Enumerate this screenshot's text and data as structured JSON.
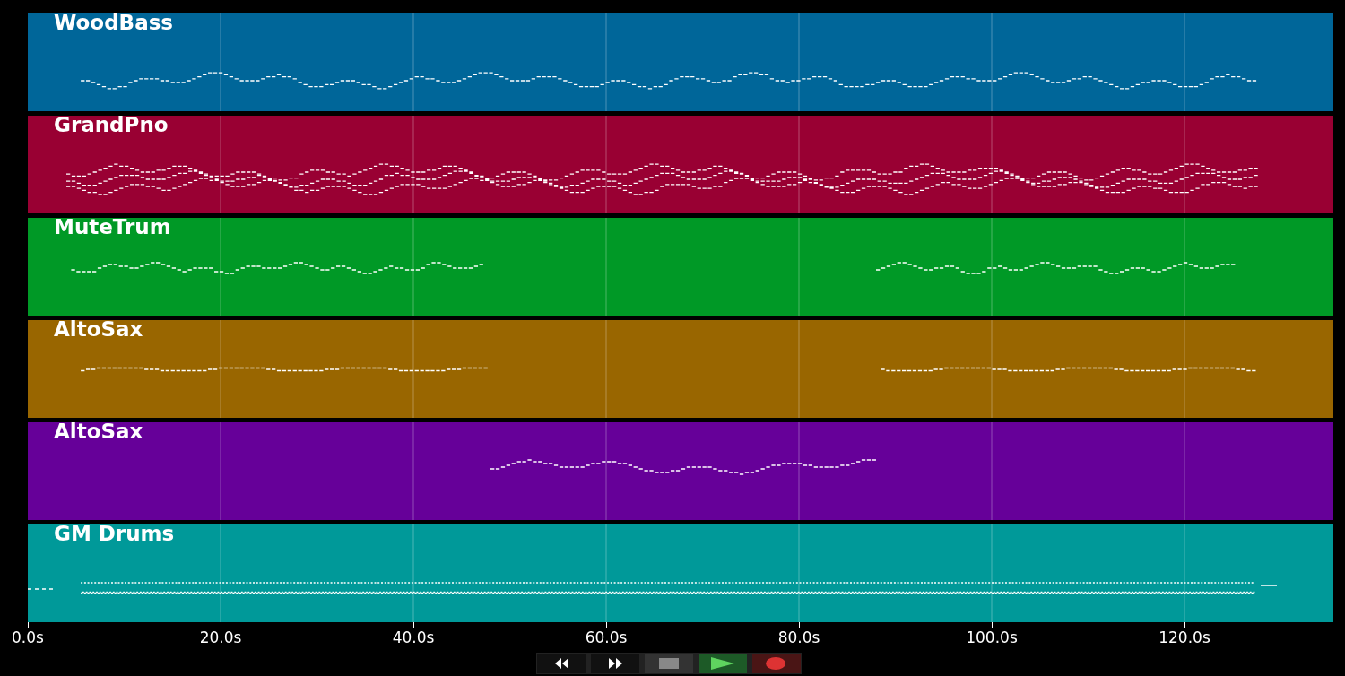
{
  "tracks": [
    {
      "name": "WoodBass",
      "color": "#006699"
    },
    {
      "name": "GrandPno",
      "color": "#990033"
    },
    {
      "name": "MuteTrum",
      "color": "#009926"
    },
    {
      "name": "AltoSax",
      "color": "#996600"
    },
    {
      "name": "AltoSax",
      "color": "#660099"
    },
    {
      "name": "GM Drums",
      "color": "#009999"
    }
  ],
  "time_axis": {
    "ticks": [
      "0.0s",
      "20.0s",
      "40.0s",
      "60.0s",
      "80.0s",
      "100.0s",
      "120.0s"
    ]
  },
  "transport": [
    {
      "kind": "rewind"
    },
    {
      "kind": "fast_forward"
    },
    {
      "kind": "stop"
    },
    {
      "kind": "play"
    },
    {
      "kind": "record"
    }
  ]
}
